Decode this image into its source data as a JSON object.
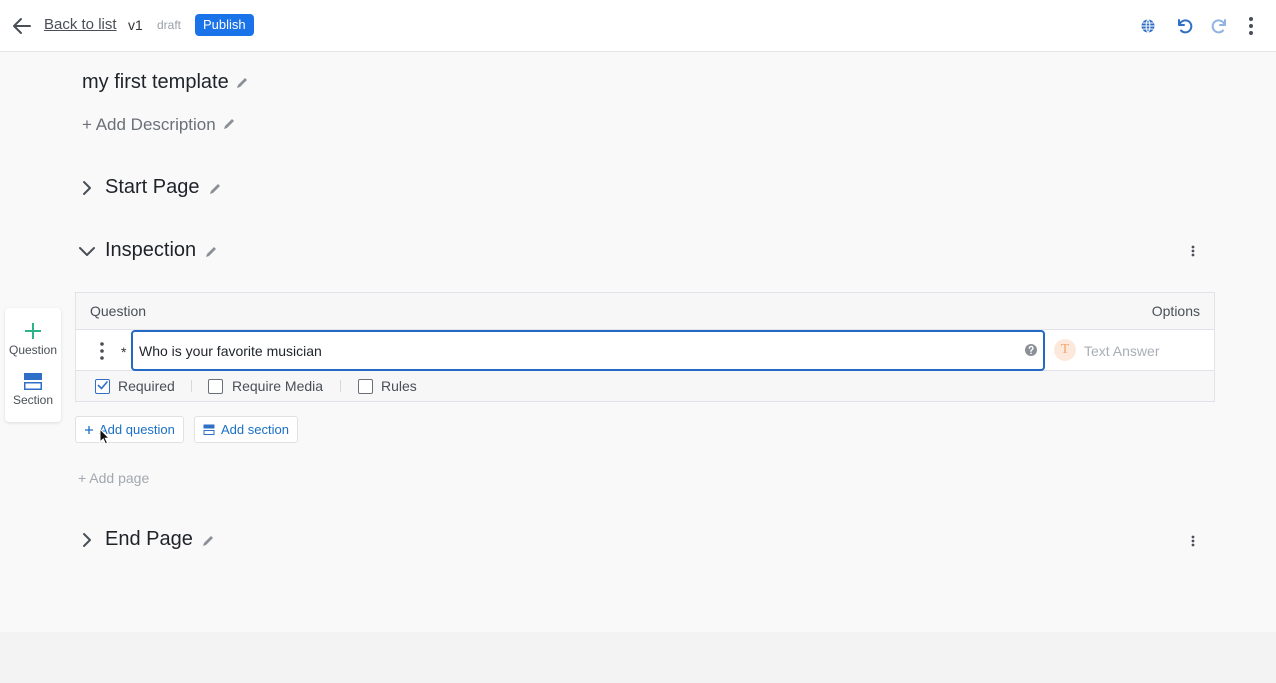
{
  "topbar": {
    "back_label": "Back to list",
    "version": "v1",
    "status": "draft",
    "publish_label": "Publish",
    "icons": [
      "back-arrow-icon",
      "globe-icon",
      "undo-icon",
      "redo-icon",
      "more-vertical-icon"
    ],
    "accent_color": "#1a73e8"
  },
  "template": {
    "title": "my first template",
    "add_description": "+ Add Description"
  },
  "pages": [
    {
      "title": "Start Page",
      "expanded": false
    },
    {
      "title": "Inspection",
      "expanded": true
    },
    {
      "title": "End Page",
      "expanded": false
    }
  ],
  "sidebar": {
    "items": [
      {
        "label": "Question",
        "icon": "plus-icon"
      },
      {
        "label": "Section",
        "icon": "section-icon"
      }
    ]
  },
  "question_table": {
    "header_question": "Question",
    "header_options": "Options",
    "rows": [
      {
        "required_mark": "*",
        "text": "Who is your favorite musician",
        "answer_badge": "T",
        "answer_type": "Text Answer",
        "options": [
          {
            "label": "Required",
            "checked": true
          },
          {
            "label": "Require Media",
            "checked": false
          },
          {
            "label": "Rules",
            "checked": false
          }
        ]
      }
    ]
  },
  "actions": {
    "add_question": "Add question",
    "add_section": "Add section",
    "add_page": "+ Add page"
  }
}
